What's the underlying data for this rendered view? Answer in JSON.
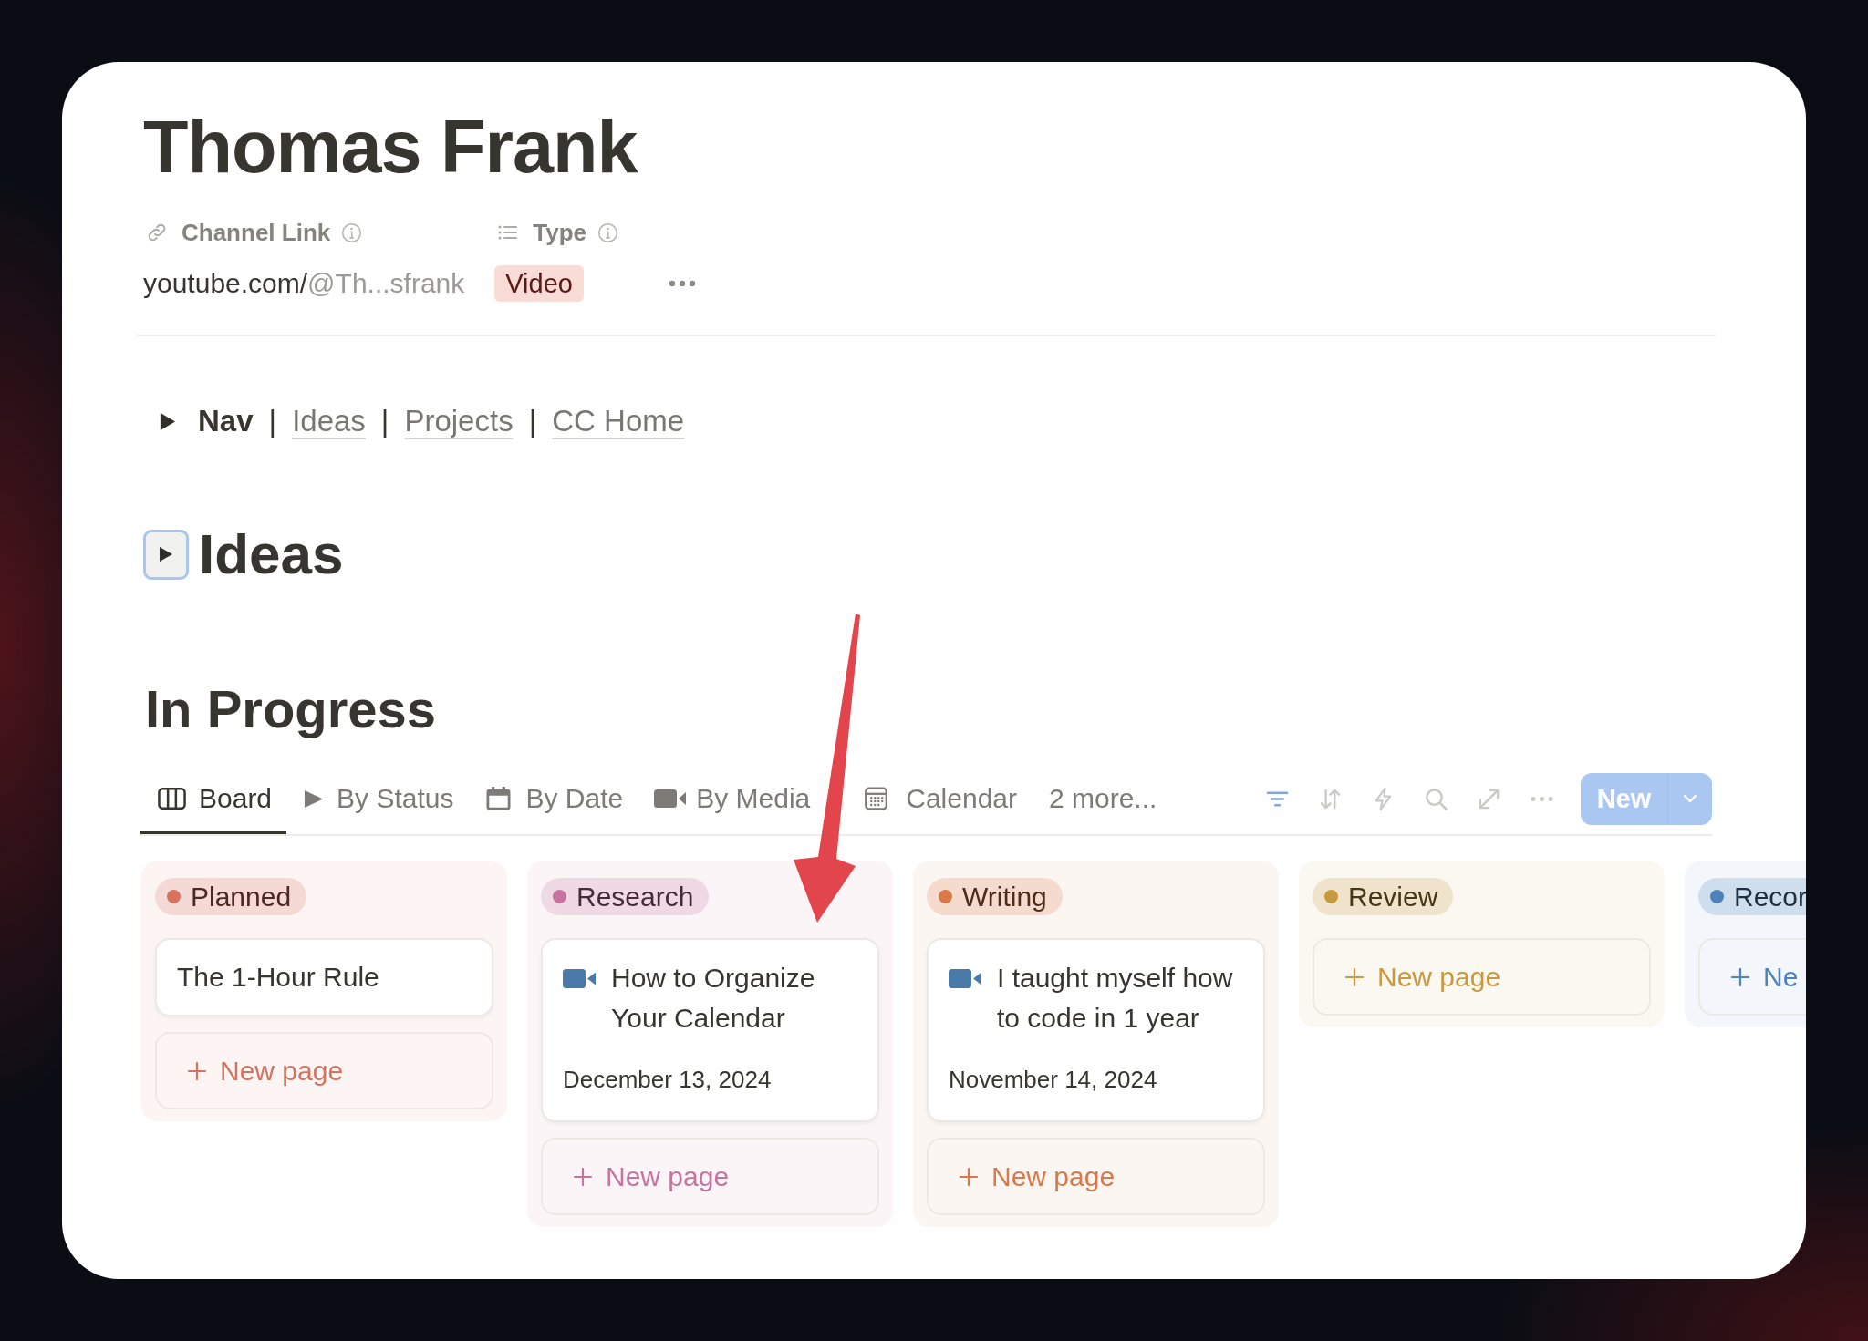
{
  "page_title": "Thomas Frank",
  "properties": [
    {
      "kind": "url",
      "name": "Channel Link",
      "value_host": "youtube.com/",
      "value_path": "@Th...sfrank"
    },
    {
      "kind": "select",
      "name": "Type",
      "value": "Video"
    }
  ],
  "nav_toggle": {
    "expanded": false,
    "items": [
      {
        "kind": "label",
        "text": "Nav"
      },
      {
        "kind": "separator",
        "text": "|"
      },
      {
        "kind": "link",
        "text": "Ideas"
      },
      {
        "kind": "separator",
        "text": "|"
      },
      {
        "kind": "link",
        "text": "Projects"
      },
      {
        "kind": "separator",
        "text": "|"
      },
      {
        "kind": "link",
        "text": "CC Home"
      }
    ]
  },
  "ideas_toggle": {
    "title": "Ideas",
    "expanded": false,
    "focused": true
  },
  "database": {
    "title": "In Progress",
    "tabs": [
      {
        "label": "Board",
        "selected": true
      },
      {
        "label": "By Status",
        "selected": false
      },
      {
        "label": "By Date",
        "selected": false
      },
      {
        "label": "By Media",
        "selected": false
      },
      {
        "label": "Calendar",
        "selected": false
      }
    ],
    "more_views": "2 more...",
    "filter_active": true,
    "new_button": "New",
    "columns": [
      {
        "name": "Planned",
        "color": "#d5735f",
        "cut_off": false,
        "cards": [
          {
            "kind": "plain",
            "title": "The 1-Hour Rule"
          }
        ],
        "new_page": "New page"
      },
      {
        "name": "Research",
        "color": "#c5749f",
        "cut_off": false,
        "cards": [
          {
            "kind": "video",
            "title": "How to Organize Your Calendar",
            "date": "December 13, 2024"
          }
        ],
        "new_page": "New page"
      },
      {
        "name": "Writing",
        "color": "#d9784a",
        "cut_off": false,
        "cards": [
          {
            "kind": "video",
            "title": "I taught myself how to code in 1 year",
            "date": "November 14, 2024"
          }
        ],
        "new_page": "New page"
      },
      {
        "name": "Review",
        "color": "#c9993f",
        "cut_off": false,
        "new_page": "New page"
      },
      {
        "name": "Recor",
        "color": "#4d83b9",
        "cut_off": true,
        "new_page": "Ne"
      }
    ]
  }
}
